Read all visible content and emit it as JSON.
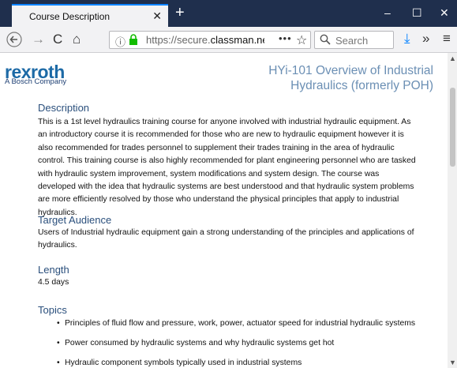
{
  "browser": {
    "tab_title": "Course Description",
    "url_prefix": "https://secure.",
    "url_domain": "classman.net",
    "url_suffix": "/",
    "search_placeholder": "Search"
  },
  "page": {
    "logo": "rexroth",
    "logo_tagline": "A Bosch Company",
    "course_title": "HYi-101 Overview of Industrial Hydraulics (formerly POH)",
    "sections": {
      "description_heading": "Description",
      "description_text": "This is a 1st level hydraulics training course for anyone involved with industrial hydraulic equipment. As an introductory course it is recommended for those who are new to hydraulic equipment however it is also recommended for trades personnel to supplement their trades training in the area of hydraulic control. This training course is also highly recommended for plant engineering personnel who are tasked with hydraulic system improvement, system modifications and system design. The course was developed with the idea that hydraulic systems are best understood and that hydraulic system problems are more efficiently resolved by those who understand the physical principles that apply to industrial hydraulics.",
      "audience_heading": "Target Audience",
      "audience_text": "Users of Industrial hydraulic equipment gain a strong understanding of the principles and applications of hydraulics.",
      "length_heading": "Length",
      "length_text": "4.5 days",
      "topics_heading": "Topics",
      "topics": [
        "Principles of fluid flow and pressure, work, power, actuator speed for industrial hydraulic systems",
        "Power consumed by hydraulic systems and why hydraulic systems get hot",
        "Hydraulic component symbols typically used in industrial systems"
      ]
    }
  }
}
